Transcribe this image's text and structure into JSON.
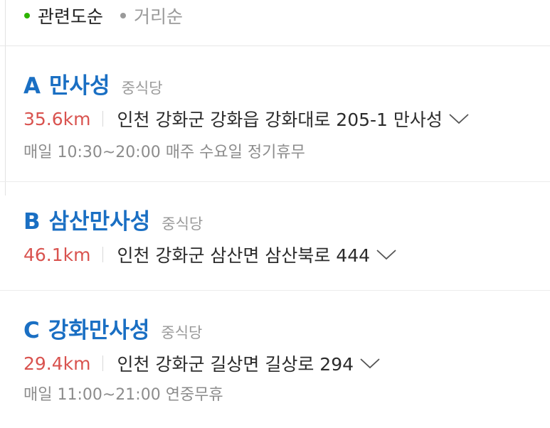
{
  "colors": {
    "accent_blue": "#1a6fc3",
    "distance_red": "#d9534f",
    "green_dot": "#2db400",
    "grey_dot": "#9a9a9a"
  },
  "sort": {
    "options": [
      {
        "label": "관련도순",
        "selected": true
      },
      {
        "label": "거리순",
        "selected": false
      }
    ]
  },
  "results": [
    {
      "marker": "A",
      "name": "만사성",
      "category": "중식당",
      "distance": "35.6km",
      "address": "인천 강화군 강화읍 강화대로 205-1 만사성",
      "expand_icon": "chevron-down-icon",
      "hours": "매일 10:30~20:00 매주 수요일 정기휴무"
    },
    {
      "marker": "B",
      "name": "삼산만사성",
      "category": "중식당",
      "distance": "46.1km",
      "address": "인천 강화군 삼산면 삼산북로 444",
      "expand_icon": "chevron-down-icon",
      "hours": ""
    },
    {
      "marker": "C",
      "name": "강화만사성",
      "category": "중식당",
      "distance": "29.4km",
      "address": "인천 강화군 길상면 길상로 294",
      "expand_icon": "chevron-down-icon",
      "hours": "매일 11:00~21:00 연중무휴"
    }
  ]
}
